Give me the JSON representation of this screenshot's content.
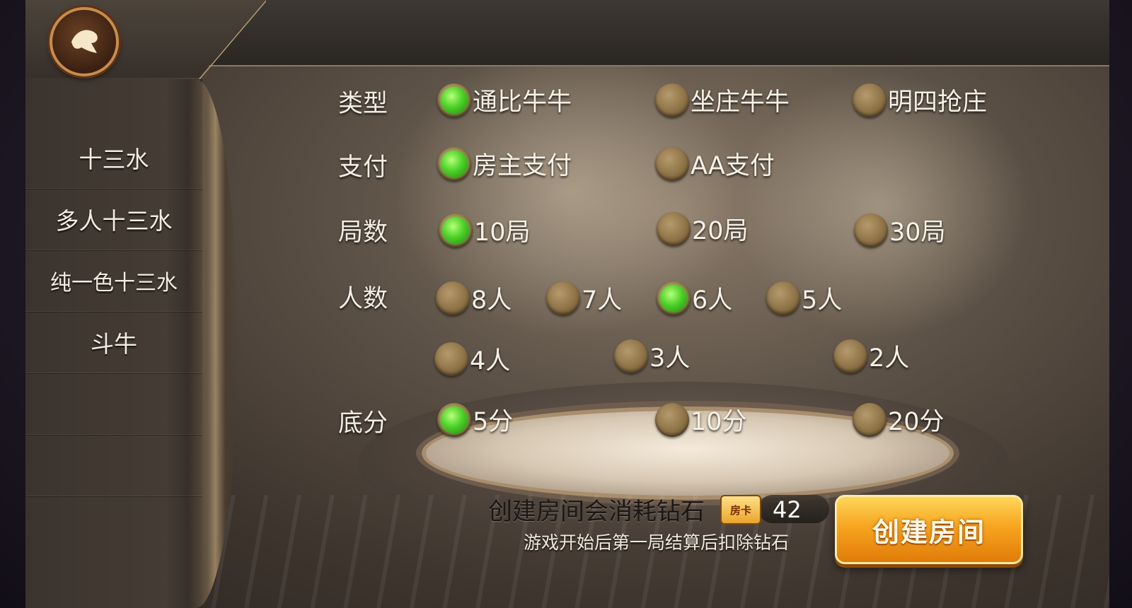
{
  "sidebar": {
    "items": [
      {
        "label": "十三水"
      },
      {
        "label": "多人十三水"
      },
      {
        "label": "纯一色十三水"
      },
      {
        "label": "斗牛"
      },
      {
        "label": ""
      },
      {
        "label": ""
      }
    ]
  },
  "settings": {
    "type": {
      "label": "类型",
      "options": [
        "通比牛牛",
        "坐庄牛牛",
        "明四抢庄"
      ],
      "selected": "通比牛牛"
    },
    "payment": {
      "label": "支付",
      "options": [
        "房主支付",
        "AA支付"
      ],
      "selected": "房主支付"
    },
    "rounds": {
      "label": "局数",
      "options": [
        "10局",
        "20局",
        "30局"
      ],
      "selected": "10局"
    },
    "players": {
      "label": "人数",
      "options": [
        "8人",
        "7人",
        "6人",
        "5人",
        "4人",
        "3人",
        "2人"
      ],
      "selected": "6人"
    },
    "base_score": {
      "label": "底分",
      "options": [
        "5分",
        "10分",
        "20分"
      ],
      "selected": "5分"
    }
  },
  "footer": {
    "cost_text": "创建房间会消耗钻石",
    "card_icon_text": "房卡",
    "diamond_count": "42",
    "note": "游戏开始后第一局结算后扣除钻石",
    "create_button": "创建房间"
  },
  "colors": {
    "selected_green": "#4fd32a",
    "unselected_gold": "#8d7246",
    "button_orange": "#f7a51f"
  },
  "icons": {
    "back": "spade-back-icon"
  }
}
